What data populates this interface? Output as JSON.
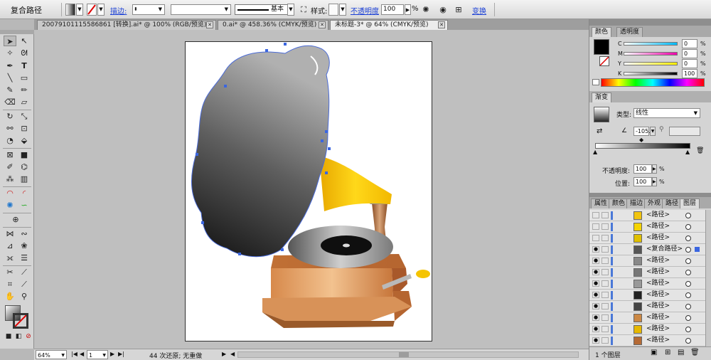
{
  "control_bar": {
    "selection_type": "复合路径",
    "stroke_label": "描边:",
    "stroke_profile": "基本",
    "style_label": "样式:",
    "opacity_label": "不透明度",
    "opacity_value": "100",
    "opacity_unit": "%",
    "transform_label": "变换"
  },
  "tabs": [
    {
      "label": "20079101115586861 [转换].ai* @ 100% (RGB/预览)"
    },
    {
      "label": "0.ai* @ 458.36% (CMYK/预览)"
    },
    {
      "label": "未标题-3* @ 64% (CMYK/预览)"
    }
  ],
  "status_bar": {
    "zoom": "64%",
    "page": "1",
    "undo_text": "44 次还原; 无重做"
  },
  "color_panel": {
    "tabs": [
      "颜色",
      "透明度"
    ],
    "channels": [
      {
        "label": "C",
        "value": "0"
      },
      {
        "label": "M",
        "value": "0"
      },
      {
        "label": "Y",
        "value": "0"
      },
      {
        "label": "K",
        "value": "100"
      }
    ],
    "fill_color": "#000000"
  },
  "gradient_panel": {
    "title": "渐变",
    "type_label": "类型:",
    "type_value": "线性",
    "angle_value": "-105.",
    "opacity_label": "不透明度:",
    "opacity_value": "100",
    "position_label": "位置:",
    "position_value": "100",
    "percent": "%"
  },
  "layers_panel": {
    "tabs": [
      "属性",
      "颜色",
      "描边",
      "外观",
      "路径",
      "图层"
    ],
    "rows": [
      {
        "name": "<路径>",
        "thumb_color": "#f1c40f"
      },
      {
        "name": "<路径>",
        "thumb_color": "#f5d300"
      },
      {
        "name": "<路径>",
        "thumb_color": "#e0c000"
      },
      {
        "name": "<复合路径>",
        "thumb_color": "#555555"
      },
      {
        "name": "<路径>",
        "thumb_color": "#888888"
      },
      {
        "name": "<路径>",
        "thumb_color": "#777777"
      },
      {
        "name": "<路径>",
        "thumb_color": "#999999"
      },
      {
        "name": "<路径>",
        "thumb_color": "#222222"
      },
      {
        "name": "<路径>",
        "thumb_color": "#444444"
      },
      {
        "name": "<路径>",
        "thumb_color": "#cc8844"
      },
      {
        "name": "<路径>",
        "thumb_color": "#e6b800"
      },
      {
        "name": "<路径>",
        "thumb_color": "#b56a35"
      },
      {
        "name": "<路径>",
        "thumb_color": "#d08a50"
      }
    ],
    "footer": "1 个图层"
  },
  "colors": {
    "accent_link": "#1a3fd6",
    "horn_dark": "#141414",
    "horn_light": "#a9a9a9",
    "cone_yellow": "#f5c400",
    "box_orange": "#d98c55"
  }
}
